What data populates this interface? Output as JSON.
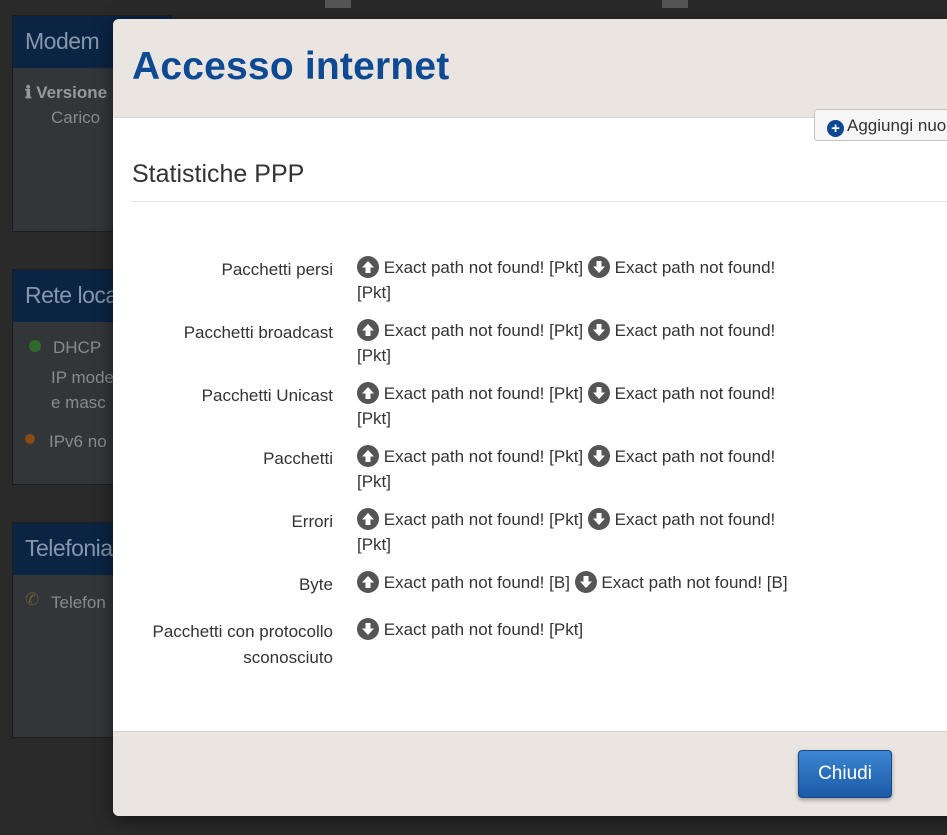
{
  "background": {
    "cards": [
      {
        "title": "Modem"
      },
      {
        "title": "Rete loca"
      },
      {
        "title": "Telefonia"
      }
    ],
    "texts": {
      "versione": "Versione",
      "carico": "Carico",
      "dhcp": "DHCP",
      "ip_mode": "IP mode",
      "e_masc": "e masc",
      "ipv6": "IPv6 no",
      "telefon": "Telefon"
    }
  },
  "modal": {
    "title": "Accesso internet",
    "add_button_label": "Aggiungi nuo",
    "section_title": "Statistiche PPP",
    "rows": [
      {
        "label": "Pacchetti persi",
        "up_text": "Exact path not found! [Pkt]",
        "down_text": "Exact path not found! [Pkt]"
      },
      {
        "label": "Pacchetti broadcast",
        "up_text": "Exact path not found! [Pkt]",
        "down_text": "Exact path not found! [Pkt]"
      },
      {
        "label": "Pacchetti Unicast",
        "up_text": "Exact path not found! [Pkt]",
        "down_text": "Exact path not found! [Pkt]"
      },
      {
        "label": "Pacchetti",
        "up_text": "Exact path not found! [Pkt]",
        "down_text": "Exact path not found! [Pkt]"
      },
      {
        "label": "Errori",
        "up_text": "Exact path not found! [Pkt]",
        "down_text": "Exact path not found! [Pkt]"
      },
      {
        "label": "Byte",
        "up_text": "Exact path not found! [B]",
        "down_text": "Exact path not found! [B]"
      },
      {
        "label": "Pacchetti con protocollo sconosciuto",
        "down_text": "Exact path not found! [Pkt]"
      }
    ],
    "close_button_label": "Chiudi"
  },
  "colors": {
    "title": "#0d4a93",
    "button": "#1a5aa6",
    "header_bg": "#ebe5e2"
  },
  "icons": {
    "up": "arrow-up-circle-icon",
    "down": "arrow-down-circle-icon",
    "add": "plus-circle-icon"
  }
}
